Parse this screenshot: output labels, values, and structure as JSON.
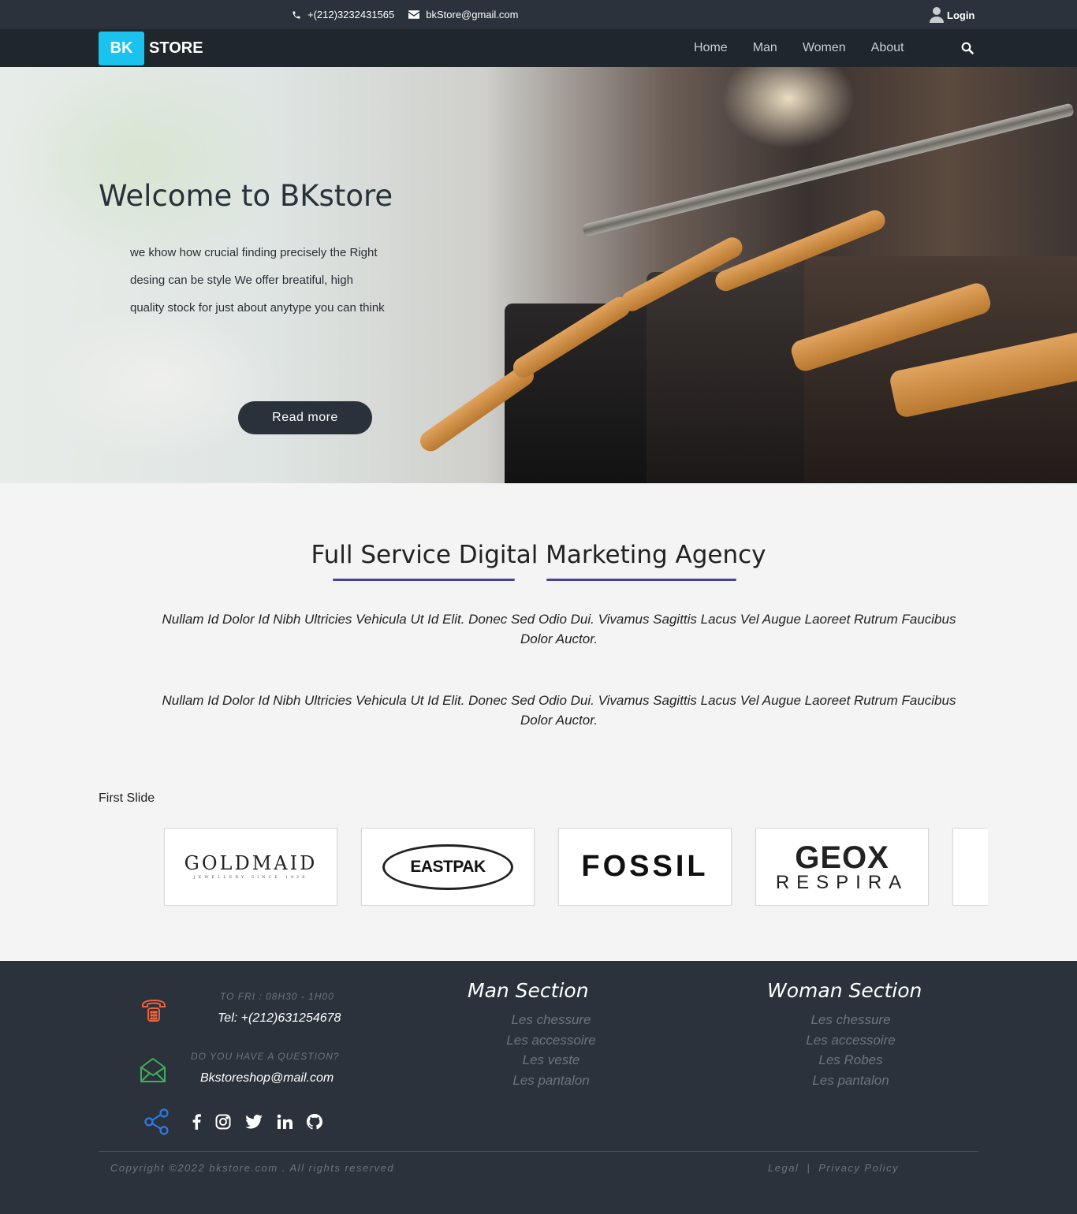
{
  "topbar": {
    "phone": "+(212)3232431565",
    "email": "bkStore@gmail.com",
    "login_label": "Login"
  },
  "navbar": {
    "logo_badge": "BK",
    "logo_text": "STORE",
    "links": [
      "Home",
      "Man",
      "Women",
      "About"
    ]
  },
  "hero": {
    "title": "Welcome to BKstore",
    "text": "we khow how crucial finding precisely the Right desing can be style We offer breatiful, high quality stock for just about anytype you can think",
    "button_label": "Read more"
  },
  "agency": {
    "title": "Full Service Digital Marketing Agency",
    "paragraph_1": "Nullam Id Dolor Id Nibh Ultricies Vehicula Ut Id Elit. Donec Sed Odio Dui. Vivamus Sagittis Lacus Vel Augue Laoreet Rutrum Faucibus Dolor Auctor.",
    "paragraph_2": "Nullam Id Dolor Id Nibh Ultricies Vehicula Ut Id Elit. Donec Sed Odio Dui. Vivamus Sagittis Lacus Vel Augue Laoreet Rutrum Faucibus Dolor Auctor.",
    "accent_color": "#4a4096"
  },
  "slider": {
    "label": "First Slide",
    "brands": {
      "goldmaid": "GOLDMAID",
      "goldmaid_tagline": "JEWELLERY SINCE 1928",
      "eastpak": "EASTPAK",
      "fossil": "FOSSIL",
      "geox_1": "GEOX",
      "geox_2": "RESPIRA"
    }
  },
  "footer": {
    "hours_caption": "TO FRI : 08H30 - 1H00",
    "phone": "Tel: +(212)631254678",
    "question_caption": "DO YOU HAVE A QUESTION?",
    "email": "Bkstoreshop@mail.com",
    "man_section": {
      "title": "Man Section",
      "items": [
        "Les chessure",
        "Les accessoire",
        "Les veste",
        "Les pantalon"
      ]
    },
    "woman_section": {
      "title": "Woman Section",
      "items": [
        "Les chessure",
        "Les accessoire",
        "Les Robes",
        "Les pantalon"
      ]
    },
    "copyright": "Copyright ©2022 bkstore.com . All rights reserved",
    "legal": "Legal",
    "separator": "|",
    "privacy": "Privacy Policy"
  },
  "colors": {
    "topbar": "#2b323b",
    "navbar": "#1f262c",
    "logo_badge": "#19c3ee",
    "footer": "#2b323b",
    "phone_icon": "#e8643c",
    "mail_icon": "#3fae5a",
    "share_icon": "#2d7be5"
  },
  "icons": [
    "phone-icon",
    "envelope-icon",
    "user-icon",
    "search-icon",
    "telephone-icon",
    "open-mail-icon",
    "share-icon",
    "facebook-icon",
    "instagram-icon",
    "twitter-icon",
    "linkedin-icon",
    "github-icon"
  ]
}
